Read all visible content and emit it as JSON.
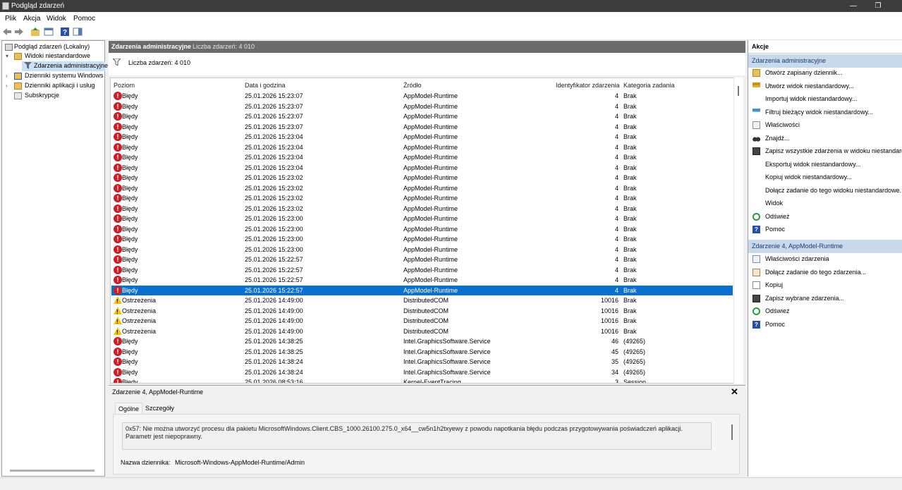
{
  "window": {
    "title": "Podgląd zdarzeń",
    "minimize": "—",
    "restore": "❐",
    "close": "✕"
  },
  "menu": [
    "Plik",
    "Akcja",
    "Widok",
    "Pomoc"
  ],
  "tree": {
    "root": "Podgląd zdarzeń (Lokalny)",
    "custom_views": "Widoki niestandardowe",
    "admin_events": "Zdarzenia administracyjne",
    "windows_logs": "Dzienniki systemu Windows",
    "app_logs": "Dzienniki aplikacji i usług",
    "subscriptions": "Subskrypcje"
  },
  "center": {
    "title": "Zdarzenia administracyjne",
    "count_header": "Liczba zdarzeń: 4 010",
    "filter_count": "Liczba zdarzeń: 4 010",
    "columns": [
      "Poziom",
      "Data i godzina",
      "Źródło",
      "Identyfikator zdarzenia",
      "Kategoria zadania"
    ],
    "rows": [
      {
        "level": "Błędy",
        "type": "error",
        "date": "25.01.2026 15:23:07",
        "source": "AppModel-Runtime",
        "id": "4",
        "cat": "Brak"
      },
      {
        "level": "Błędy",
        "type": "error",
        "date": "25.01.2026 15:23:07",
        "source": "AppModel-Runtime",
        "id": "4",
        "cat": "Brak"
      },
      {
        "level": "Błędy",
        "type": "error",
        "date": "25.01.2026 15:23:07",
        "source": "AppModel-Runtime",
        "id": "4",
        "cat": "Brak"
      },
      {
        "level": "Błędy",
        "type": "error",
        "date": "25.01.2026 15:23:07",
        "source": "AppModel-Runtime",
        "id": "4",
        "cat": "Brak"
      },
      {
        "level": "Błędy",
        "type": "error",
        "date": "25.01.2026 15:23:04",
        "source": "AppModel-Runtime",
        "id": "4",
        "cat": "Brak"
      },
      {
        "level": "Błędy",
        "type": "error",
        "date": "25.01.2026 15:23:04",
        "source": "AppModel-Runtime",
        "id": "4",
        "cat": "Brak"
      },
      {
        "level": "Błędy",
        "type": "error",
        "date": "25.01.2026 15:23:04",
        "source": "AppModel-Runtime",
        "id": "4",
        "cat": "Brak"
      },
      {
        "level": "Błędy",
        "type": "error",
        "date": "25.01.2026 15:23:04",
        "source": "AppModel-Runtime",
        "id": "4",
        "cat": "Brak"
      },
      {
        "level": "Błędy",
        "type": "error",
        "date": "25.01.2026 15:23:02",
        "source": "AppModel-Runtime",
        "id": "4",
        "cat": "Brak"
      },
      {
        "level": "Błędy",
        "type": "error",
        "date": "25.01.2026 15:23:02",
        "source": "AppModel-Runtime",
        "id": "4",
        "cat": "Brak"
      },
      {
        "level": "Błędy",
        "type": "error",
        "date": "25.01.2026 15:23:02",
        "source": "AppModel-Runtime",
        "id": "4",
        "cat": "Brak"
      },
      {
        "level": "Błędy",
        "type": "error",
        "date": "25.01.2026 15:23:02",
        "source": "AppModel-Runtime",
        "id": "4",
        "cat": "Brak"
      },
      {
        "level": "Błędy",
        "type": "error",
        "date": "25.01.2026 15:23:00",
        "source": "AppModel-Runtime",
        "id": "4",
        "cat": "Brak"
      },
      {
        "level": "Błędy",
        "type": "error",
        "date": "25.01.2026 15:23:00",
        "source": "AppModel-Runtime",
        "id": "4",
        "cat": "Brak"
      },
      {
        "level": "Błędy",
        "type": "error",
        "date": "25.01.2026 15:23:00",
        "source": "AppModel-Runtime",
        "id": "4",
        "cat": "Brak"
      },
      {
        "level": "Błędy",
        "type": "error",
        "date": "25.01.2026 15:23:00",
        "source": "AppModel-Runtime",
        "id": "4",
        "cat": "Brak"
      },
      {
        "level": "Błędy",
        "type": "error",
        "date": "25.01.2026 15:22:57",
        "source": "AppModel-Runtime",
        "id": "4",
        "cat": "Brak"
      },
      {
        "level": "Błędy",
        "type": "error",
        "date": "25.01.2026 15:22:57",
        "source": "AppModel-Runtime",
        "id": "4",
        "cat": "Brak"
      },
      {
        "level": "Błędy",
        "type": "error",
        "date": "25.01.2026 15:22:57",
        "source": "AppModel-Runtime",
        "id": "4",
        "cat": "Brak"
      },
      {
        "level": "Błędy",
        "type": "error",
        "date": "25.01.2026 15:22:57",
        "source": "AppModel-Runtime",
        "id": "4",
        "cat": "Brak",
        "selected": true
      },
      {
        "level": "Ostrzeżenia",
        "type": "warn",
        "date": "25.01.2026 14:49:00",
        "source": "DistributedCOM",
        "id": "10016",
        "cat": "Brak"
      },
      {
        "level": "Ostrzeżenia",
        "type": "warn",
        "date": "25.01.2026 14:49:00",
        "source": "DistributedCOM",
        "id": "10016",
        "cat": "Brak"
      },
      {
        "level": "Ostrzeżenia",
        "type": "warn",
        "date": "25.01.2026 14:49:00",
        "source": "DistributedCOM",
        "id": "10016",
        "cat": "Brak"
      },
      {
        "level": "Ostrzeżenia",
        "type": "warn",
        "date": "25.01.2026 14:49:00",
        "source": "DistributedCOM",
        "id": "10016",
        "cat": "Brak"
      },
      {
        "level": "Błędy",
        "type": "error",
        "date": "25.01.2026 14:38:25",
        "source": "Intel.GraphicsSoftware.Service",
        "id": "46",
        "cat": "(49265)"
      },
      {
        "level": "Błędy",
        "type": "error",
        "date": "25.01.2026 14:38:25",
        "source": "Intel.GraphicsSoftware.Service",
        "id": "45",
        "cat": "(49265)"
      },
      {
        "level": "Błędy",
        "type": "error",
        "date": "25.01.2026 14:38:24",
        "source": "Intel.GraphicsSoftware.Service",
        "id": "35",
        "cat": "(49265)"
      },
      {
        "level": "Błędy",
        "type": "error",
        "date": "25.01.2026 14:38:24",
        "source": "Intel.GraphicsSoftware.Service",
        "id": "34",
        "cat": "(49265)"
      },
      {
        "level": "Błędy",
        "type": "error",
        "date": "25.01.2026 08:53:16",
        "source": "Kernel-EventTracing",
        "id": "3",
        "cat": "Session"
      }
    ]
  },
  "detail": {
    "title": "Zdarzenie 4, AppModel-Runtime",
    "close": "✕",
    "tabs": [
      "Ogólne",
      "Szczegóły"
    ],
    "message": "0x57: Nie można utworzyć procesu dla pakietu MicrosoftWindows.Client.CBS_1000.26100.275.0_x64__cw5n1h2txyewy z powodu napotkania błędu podczas przygotowywania poświadczeń aplikacji. Parametr jest niepoprawny.",
    "log_name_label": "Nazwa dziennika:",
    "log_name_value": "Microsoft-Windows-AppModel-Runtime/Admin"
  },
  "actions": {
    "header": "Akcje",
    "section1": "Zdarzenia administracyjne",
    "items1": [
      {
        "label": "Otwórz zapisany dziennik...",
        "icon": "folder-open-icon"
      },
      {
        "label": "Utwórz widok niestandardowy...",
        "icon": "filter-create-icon"
      },
      {
        "label": "Importuj widok niestandardowy...",
        "icon": ""
      },
      {
        "label": "Filtruj bieżący widok niestandardowy...",
        "icon": "filter-icon"
      },
      {
        "label": "Właściwości",
        "icon": "properties-icon"
      },
      {
        "label": "Znajdź...",
        "icon": "binoculars-icon"
      },
      {
        "label": "Zapisz wszystkie zdarzenia w widoku niestandard...",
        "icon": "save-icon"
      },
      {
        "label": "Eksportuj widok niestandardowy...",
        "icon": ""
      },
      {
        "label": "Kopiuj widok niestandardowy...",
        "icon": ""
      },
      {
        "label": "Dołącz zadanie do tego widoku niestandardowe...",
        "icon": ""
      },
      {
        "label": "Widok",
        "icon": ""
      },
      {
        "label": "Odśwież",
        "icon": "refresh-icon"
      },
      {
        "label": "Pomoc",
        "icon": "help-icon"
      }
    ],
    "section2": "Zdarzenie 4, AppModel-Runtime",
    "items2": [
      {
        "label": "Właściwości zdarzenia",
        "icon": "properties-icon"
      },
      {
        "label": "Dołącz zadanie do tego zdarzenia...",
        "icon": "task-icon"
      },
      {
        "label": "Kopiuj",
        "icon": "copy-icon"
      },
      {
        "label": "Zapisz wybrane zdarzenia...",
        "icon": "save-icon"
      },
      {
        "label": "Odśwież",
        "icon": "refresh-icon"
      },
      {
        "label": "Pomoc",
        "icon": "help-icon"
      }
    ]
  },
  "colors": {
    "selection": "#0a6fcf",
    "error": "#c8202a",
    "warning": "#f4c400",
    "section_bg": "#c9d9ec"
  }
}
